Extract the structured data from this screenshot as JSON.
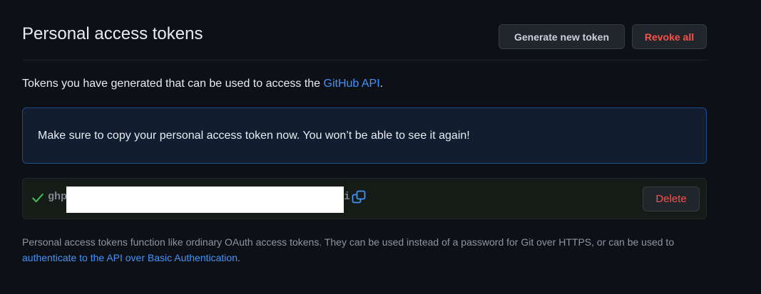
{
  "header": {
    "title": "Personal access tokens",
    "generate_label": "Generate new token",
    "revoke_label": "Revoke all"
  },
  "intro": {
    "text": "Tokens you have generated that can be used to access the ",
    "link": "GitHub API",
    "suffix": "."
  },
  "flash": {
    "message": "Make sure to copy your personal access token now. You won’t be able to see it again!"
  },
  "token": {
    "prefix": "ghp",
    "suffix": "i",
    "delete_label": "Delete",
    "icons": {
      "status": "check-icon",
      "copy": "copy-icon"
    }
  },
  "footer_note": {
    "text": "Personal access tokens function like ordinary OAuth access tokens. They can be used instead of a password for Git over HTTPS, or can be used to ",
    "link": "authenticate to the API over Basic Authentication",
    "suffix": "."
  },
  "colors": {
    "background": "#0d1117",
    "accent_link": "#4493f8",
    "danger": "#f85149",
    "success": "#3fb950"
  }
}
